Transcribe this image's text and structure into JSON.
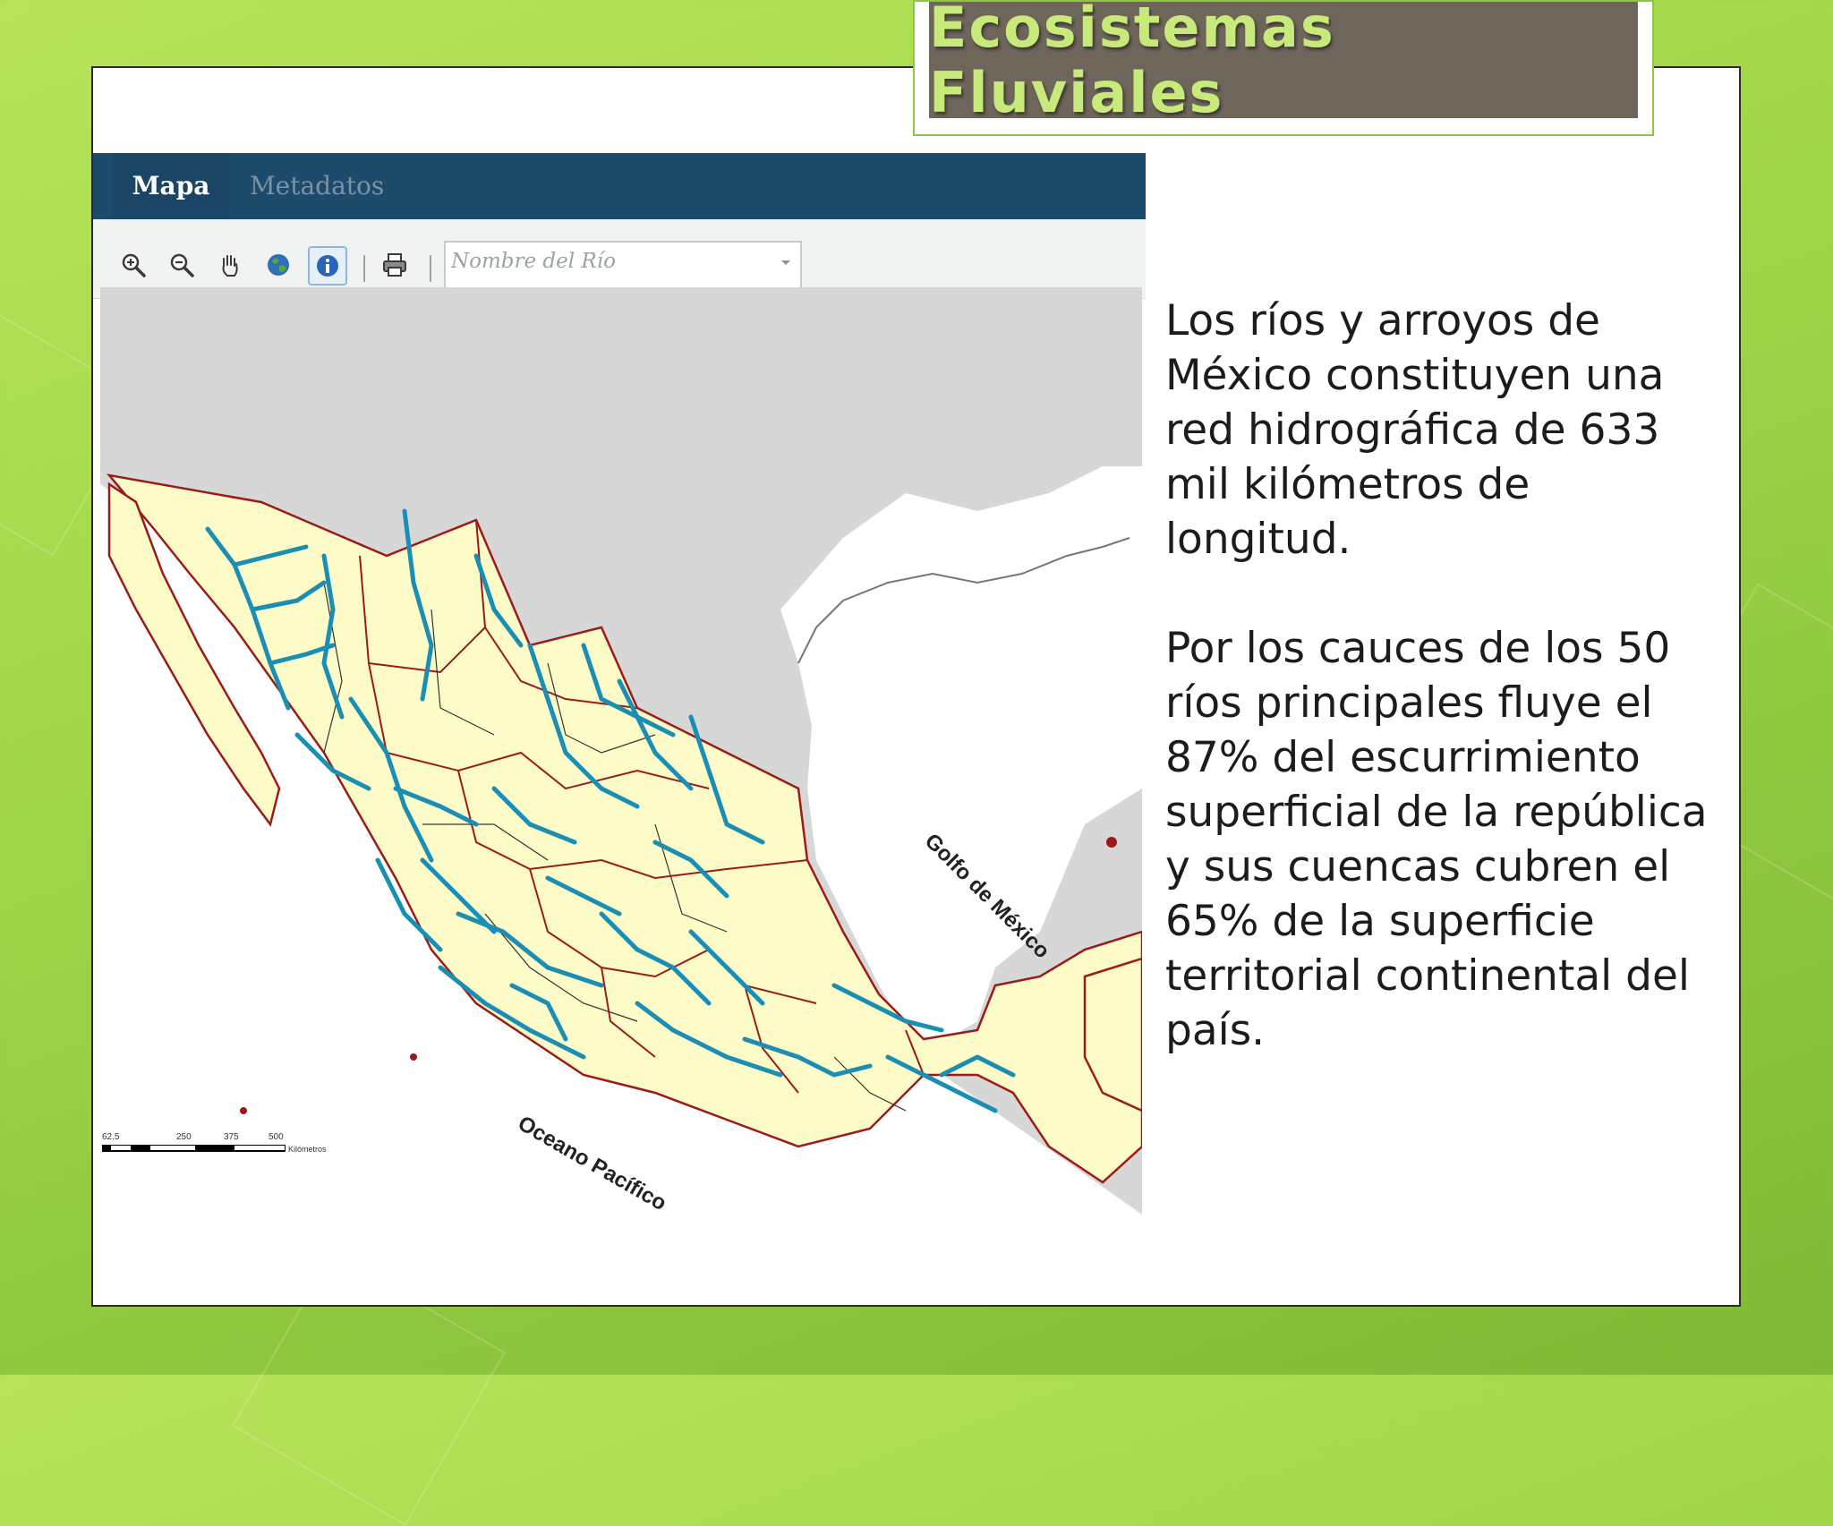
{
  "slide": {
    "title": "Ecosistemas Fluviales",
    "paragraphs": [
      "Los ríos y arroyos de México constituyen una red hidrográfica de 633 mil kilómetros de longitud.",
      "Por los cauces de los 50 ríos principales fluye el 87% del escurrimiento superficial de la república y sus cuencas cubren el 65% de la superficie territorial continental del país."
    ]
  },
  "map_app": {
    "tabs": [
      {
        "label": "Mapa",
        "active": true
      },
      {
        "label": "Metadatos",
        "active": false
      }
    ],
    "toolbar": {
      "tools": [
        "zoom-in-icon",
        "zoom-out-icon",
        "pan-hand-icon",
        "globe-icon",
        "info-icon",
        "print-icon"
      ],
      "river_select": {
        "placeholder": "Nombre del Río",
        "value": ""
      }
    },
    "map": {
      "labels": {
        "gulf": "Golfo de México",
        "ocean": "Oceano Pacífico"
      },
      "scale_bar": {
        "ticks": [
          "62.5",
          "250",
          "375",
          "500"
        ],
        "unit": "Kilómetros"
      },
      "colors": {
        "land": "#fdfbc7",
        "sea_gray": "#d7d7d7",
        "rivers": "#1b8fb3",
        "state_borders": "#9b1b1b",
        "basin_borders": "#333333"
      }
    }
  }
}
